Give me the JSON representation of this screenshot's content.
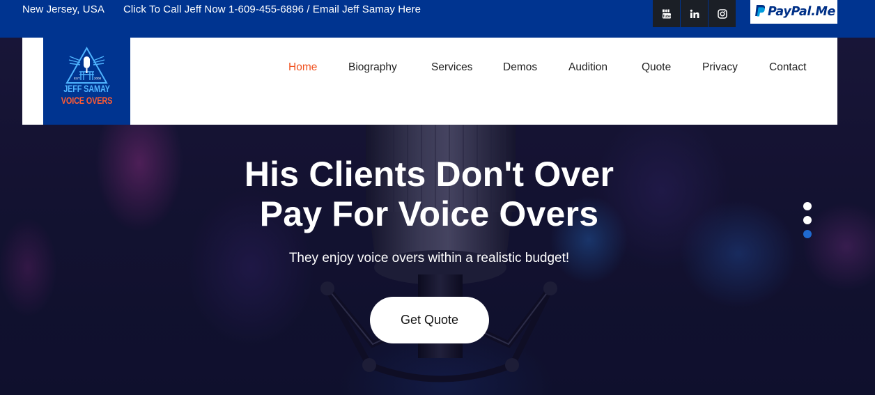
{
  "topbar": {
    "location": "New Jersey, USA",
    "contact": "Click To Call Jeff Now 1-609-455-6896 / Email Jeff Samay Here",
    "social": [
      {
        "name": "youtube",
        "icon": "youtube-icon"
      },
      {
        "name": "linkedin",
        "icon": "linkedin-icon"
      },
      {
        "name": "instagram",
        "icon": "instagram-icon"
      }
    ],
    "paypal_label": "PayPal.Me"
  },
  "logo": {
    "line1": "JEFF SAMAY",
    "line2": "VOICE OVERS",
    "year_left": "EST",
    "year_right": "2008"
  },
  "nav": {
    "items": [
      {
        "label": "Home",
        "active": true
      },
      {
        "label": "Biography",
        "active": false
      },
      {
        "label": "Services",
        "active": false
      },
      {
        "label": "Demos",
        "active": false
      },
      {
        "label": "Audition",
        "active": false
      },
      {
        "label": "Quote",
        "active": false
      },
      {
        "label": "Privacy",
        "active": false
      },
      {
        "label": "Contact",
        "active": false
      }
    ]
  },
  "hero": {
    "title_line1": "His Clients Don't Over",
    "title_line2": "Pay For Voice Overs",
    "subtitle": "They enjoy voice overs within a realistic budget!",
    "cta_label": "Get Quote",
    "slider": {
      "count": 3,
      "active_index": 2
    }
  },
  "colors": {
    "brand_blue": "#003490",
    "accent_orange": "#f0501e",
    "slider_active": "#1f6ad0",
    "social_bg": "#1b1f26"
  }
}
